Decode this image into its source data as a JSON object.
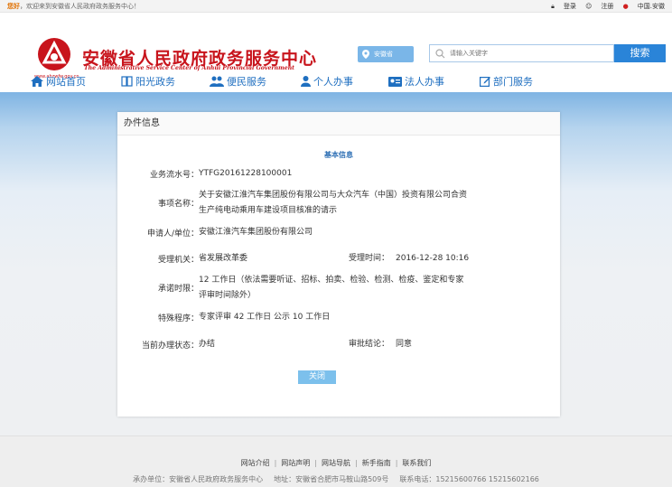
{
  "topbar": {
    "hello": "您好",
    "welcome": "，欢迎来到安徽省人民政府政务服务中心！",
    "login": "登录",
    "register": "注册",
    "location": "中国.安徽"
  },
  "header": {
    "title": "安徽省人民政府政务服务中心",
    "subtitle": "The Administrative Service Center of Anhui Provincial Government",
    "logo_url": "www.ahzwfw.gov.cn",
    "region": "安徽省",
    "search_placeholder": "请输入关键字",
    "search_button": "搜索"
  },
  "nav": {
    "items": [
      {
        "label": "网站首页",
        "icon": "home-icon"
      },
      {
        "label": "阳光政务",
        "icon": "book-icon"
      },
      {
        "label": "便民服务",
        "icon": "people-icon"
      },
      {
        "label": "个人办事",
        "icon": "person-icon"
      },
      {
        "label": "法人办事",
        "icon": "id-card-icon"
      },
      {
        "label": "部门服务",
        "icon": "edit-icon"
      }
    ]
  },
  "panel": {
    "header": "办件信息",
    "section_title": "基本信息",
    "fields": {
      "serial_label": "业务流水号：",
      "serial_value": "YTFG20161228100001",
      "item_label": "事项名称：",
      "item_value_line1": "关于安徽江淮汽车集团股份有限公司与大众汽车（中国）投资有限公司合资",
      "item_value_line2": "生产纯电动乘用车建设项目核准的请示",
      "applicant_label": "申请人/单位：",
      "applicant_value": "安徽江淮汽车集团股份有限公司",
      "agency_label": "受理机关：",
      "agency_value": "省发展改革委",
      "time_label": "受理时间：",
      "time_value": "2016-12-28 10:16",
      "promise_label": "承诺时限：",
      "promise_value_line1": "12 工作日（依法需要听证、招标、拍卖、检验、检测、检疫、鉴定和专家",
      "promise_value_line2": "评审时间除外）",
      "special_label": "特殊程序：",
      "special_value": "专家评审 42 工作日 公示 10 工作日",
      "status_label": "当前办理状态：",
      "status_value": "办结",
      "conclusion_label": "审批结论：",
      "conclusion_value": "同意"
    },
    "close_button": "关闭"
  },
  "footer": {
    "links": [
      "网站介绍",
      "网站声明",
      "网站导航",
      "新手指南",
      "联系我们"
    ],
    "host": "承办单位：安徽省人民政府政务服务中心",
    "address": "地址：安徽省合肥市马鞍山路509号",
    "phone": "联系电话：15215600766 15215602166"
  },
  "colors": {
    "brand_red": "#c8141c",
    "nav_blue": "#1f6fc0",
    "search_blue": "#2a84d8",
    "section_title": "#2a6db3",
    "close_button": "#7cc0ec"
  }
}
